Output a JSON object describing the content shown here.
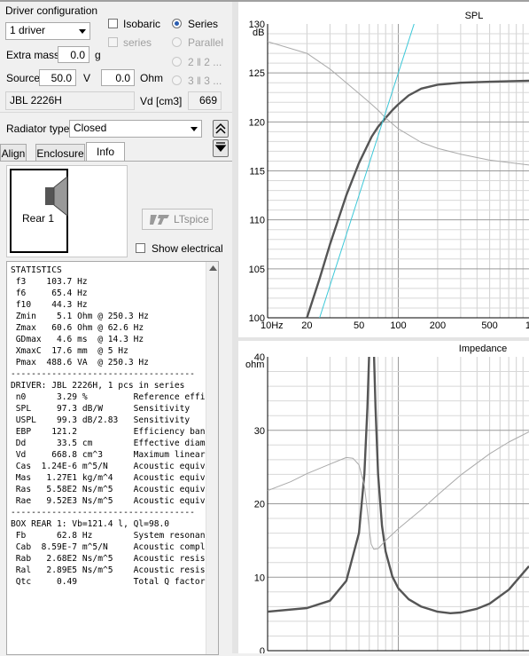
{
  "driver_config": {
    "title": "Driver configuration",
    "driver_count": "1 driver",
    "isobaric_label": "Isobaric",
    "series_label": "series",
    "radio_series": "Series",
    "radio_parallel": "Parallel",
    "radio_22": "2 ‖ 2 ...",
    "radio_33": "3 ‖ 3 ...",
    "extra_mass_label": "Extra mass",
    "extra_mass_value": "0.0",
    "extra_mass_unit": "g",
    "source_label": "Source",
    "source_voltage": "50.0",
    "voltage_unit": "V",
    "source_ohm": "0.0",
    "ohm_unit": "Ohm",
    "driver_name": "JBL 2226H",
    "vd_label": "Vd [cm3]",
    "vd_value": "669"
  },
  "radiator": {
    "label": "Radiator type",
    "value": "Closed"
  },
  "tabs": [
    "Align",
    "Enclosure",
    "Info"
  ],
  "info": {
    "enclosure_label": "Rear 1",
    "ltspice_label": "LTspice",
    "show_electrical_label": "Show electrical"
  },
  "stats_lines": [
    "STATISTICS",
    " f3    103.7 Hz",
    " f6     65.4 Hz",
    " f10    44.3 Hz",
    " Zmin    5.1 Ohm @ 250.3 Hz",
    " Zmax   60.6 Ohm @ 62.6 Hz",
    " GDmax   4.6 ms  @ 14.3 Hz",
    " XmaxC  17.6 mm  @ 5 Hz",
    " Pmax  488.6 VA  @ 250.3 Hz",
    "------------------------------------",
    "DRIVER: JBL 2226H, 1 pcs in series",
    " n0      3.29 %         Reference effi",
    " SPL     97.3 dB/W      Sensitivity",
    " USPL    99.3 dB/2.83   Sensitivity",
    " EBP    121.2           Efficiency ban",
    " Dd      33.5 cm        Effective diam",
    " Vd     668.8 cm^3      Maximum linear",
    " Cas  1.24E-6 m^5/N     Acoustic equiv",
    " Mas   1.27E1 kg/m^4    Acoustic equiv",
    " Ras   5.58E2 Ns/m^5    Acoustic equiv",
    " Rae   9.52E3 Ns/m^5    Acoustic equiv",
    "------------------------------------",
    "BOX REAR 1: Vb=121.4 l, Ql=98.0",
    " Fb      62.8 Hz        System resonan",
    " Cab  8.59E-7 m^5/N     Acoustic compl",
    " Rab   2.68E2 Ns/m^5    Acoustic resis",
    " Ral   2.89E5 Ns/m^5    Acoustic resis",
    " Qtc     0.49           Total Q factor"
  ],
  "chart_data": [
    {
      "type": "line",
      "title": "SPL",
      "ylabel": "dB",
      "x_scale": "log",
      "xlim": [
        10,
        1000
      ],
      "ylim": [
        100,
        130
      ],
      "x_tick_labels": [
        "10Hz",
        "20",
        "50",
        "100",
        "200",
        "500",
        "1"
      ],
      "y_tick_labels": [
        "130",
        "125",
        "120",
        "115",
        "110",
        "105",
        "100"
      ],
      "grid": true,
      "series": [
        {
          "color": "#555555",
          "x": [
            20,
            25,
            30,
            40,
            50,
            62.6,
            70,
            80,
            90,
            100,
            120,
            150,
            200,
            300,
            500,
            1000
          ],
          "y": [
            100,
            104,
            107.5,
            112.5,
            115.8,
            118.5,
            119.5,
            120.4,
            121.2,
            121.8,
            122.7,
            123.4,
            123.8,
            124.0,
            124.1,
            124.2
          ]
        },
        {
          "color": "#aaaaaa",
          "x": [
            10,
            20,
            30,
            40,
            50,
            60,
            70,
            80,
            100,
            150,
            200,
            300,
            500,
            1000
          ],
          "y": [
            128.2,
            127.0,
            125.4,
            124.0,
            122.9,
            122.0,
            121.2,
            120.4,
            119.3,
            117.9,
            117.3,
            116.7,
            116.1,
            115.6
          ]
        },
        {
          "color": "#3cc8d8",
          "x": [
            25,
            50,
            100,
            150
          ],
          "y": [
            100,
            112.5,
            125,
            132.3
          ]
        }
      ]
    },
    {
      "type": "line",
      "title": "Impedance",
      "ylabel": "ohm",
      "x_scale": "log",
      "xlim": [
        10,
        1000
      ],
      "ylim": [
        0,
        40
      ],
      "y_tick_labels": [
        "40",
        "30",
        "20",
        "10",
        "0"
      ],
      "grid": true,
      "series": [
        {
          "color": "#555555",
          "x": [
            10,
            20,
            30,
            40,
            50,
            55,
            58,
            60,
            61.5,
            62.6,
            63.7,
            65,
            67,
            70,
            75,
            80,
            90,
            100,
            120,
            150,
            200,
            250.3,
            300,
            400,
            500,
            700,
            1000
          ],
          "y": [
            5.3,
            5.8,
            6.8,
            9.5,
            16,
            24,
            33,
            41,
            50,
            60.6,
            50,
            41,
            33,
            24,
            17,
            13.5,
            10.1,
            8.5,
            7.0,
            6.0,
            5.3,
            5.1,
            5.2,
            5.7,
            6.4,
            8.3,
            11.5
          ]
        },
        {
          "color": "#aaaaaa",
          "x": [
            10,
            15,
            20,
            30,
            40,
            45,
            50,
            55,
            58,
            60,
            62,
            65,
            70,
            80,
            100,
            150,
            200,
            300,
            500,
            700,
            1000
          ],
          "y": [
            21.8,
            23.0,
            24.1,
            25.4,
            26.3,
            26.2,
            25.3,
            22.5,
            19,
            16.5,
            14.5,
            13.8,
            13.9,
            15.0,
            16.6,
            19.2,
            21.2,
            23.9,
            26.8,
            28.4,
            29.8
          ]
        }
      ]
    }
  ]
}
